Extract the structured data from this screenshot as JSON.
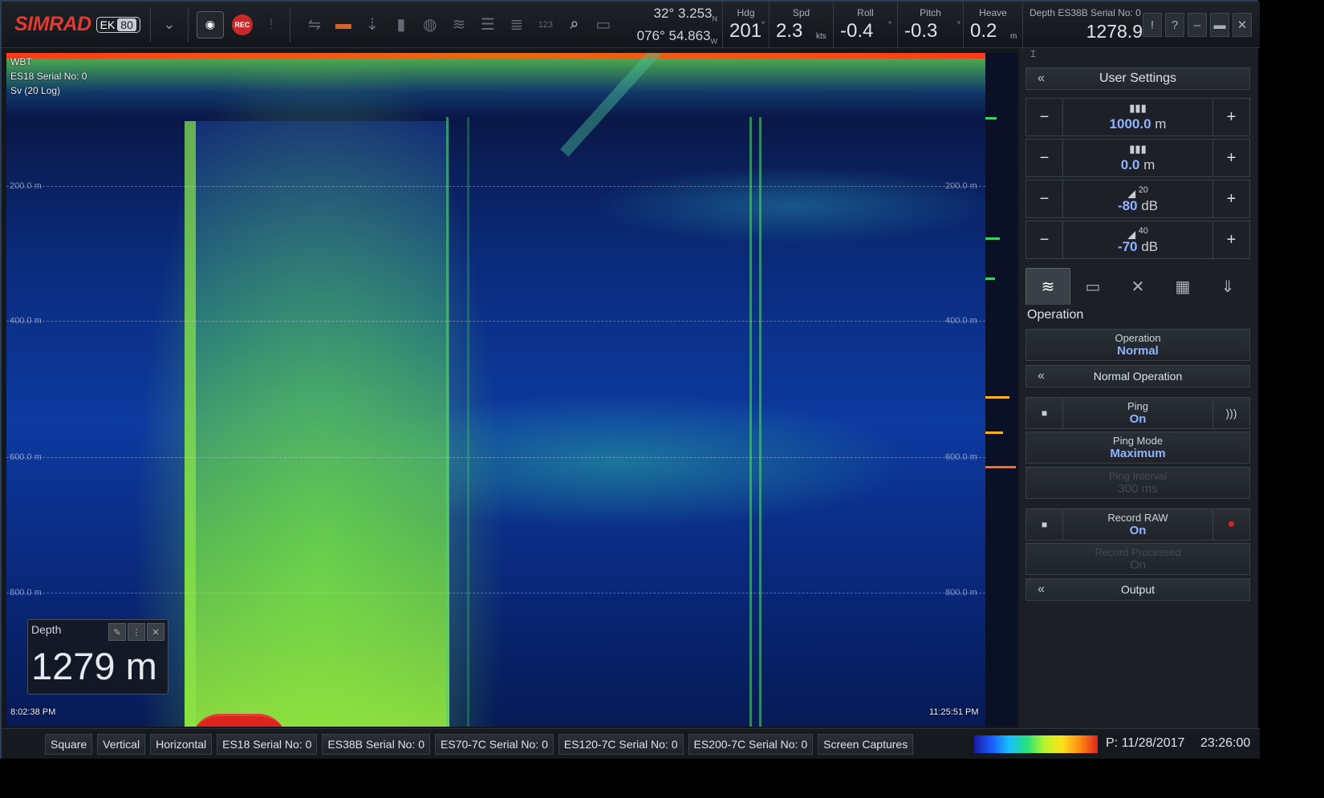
{
  "app": {
    "brand": "SIMRAD",
    "model": "EK",
    "model_num": "80"
  },
  "toolbar": {
    "rec_label": "REC",
    "icons": [
      "chevron-double-down-icon",
      "camera-icon",
      "record-icon",
      "alert-icon",
      "swap-icon",
      "palette-icon",
      "adjust-icon",
      "bar-chart-icon",
      "compass-icon",
      "echogram-icon",
      "layers-icon",
      "list-icon",
      "digits-icon",
      "magnifier-icon",
      "battery-icon"
    ]
  },
  "position": {
    "lat": "32° 3.253",
    "lat_hemi": "N",
    "lon": "076° 54.863",
    "lon_hemi": "W"
  },
  "stats": {
    "hdg": {
      "label": "Hdg",
      "value": "201",
      "unit": "°"
    },
    "spd": {
      "label": "Spd",
      "value": "2.3",
      "unit": "kts"
    },
    "roll": {
      "label": "Roll",
      "value": "-0.4",
      "unit": "°"
    },
    "pitch": {
      "label": "Pitch",
      "value": "-0.3",
      "unit": "°"
    },
    "heave": {
      "label": "Heave",
      "value": "0.2",
      "unit": "m"
    }
  },
  "depth_top": {
    "label": "Depth ES38B Serial No: 0",
    "value": "1278.9"
  },
  "echogram": {
    "mode": "WBT",
    "channel": "ES18 Serial No: 0",
    "type": "Sv (20 Log)",
    "grid": [
      "200.0 m",
      "400.0 m",
      "600.0 m",
      "800.0 m"
    ],
    "start_time": "8:02:38 PM",
    "end_time": "11:25:51 PM"
  },
  "depth_box": {
    "label": "Depth",
    "value": "1279 m"
  },
  "panel": {
    "title": "User Settings",
    "range": {
      "value": "1000.0",
      "unit": "m"
    },
    "start": {
      "value": "0.0",
      "unit": "m"
    },
    "tvg20": {
      "sup": "20",
      "value": "-80",
      "unit": "dB"
    },
    "tvg40": {
      "sup": "40",
      "value": "-70",
      "unit": "dB"
    },
    "section": "Operation",
    "operation": {
      "label": "Operation",
      "value": "Normal"
    },
    "normal_op": "Normal Operation",
    "ping": {
      "label": "Ping",
      "value": "On"
    },
    "ping_mode": {
      "label": "Ping Mode",
      "value": "Maximum"
    },
    "ping_interval": {
      "label": "Ping Interval",
      "value": "300 ms"
    },
    "record_raw": {
      "label": "Record RAW",
      "value": "On"
    },
    "record_proc": {
      "label": "Record Processed",
      "value": "On"
    },
    "output": "Output"
  },
  "bottom": {
    "tabs": [
      "Square",
      "Vertical",
      "Horizontal",
      "ES18 Serial No: 0",
      "ES38B Serial No: 0",
      "ES70-7C Serial No: 0",
      "ES120-7C Serial No: 0",
      "ES200-7C Serial No: 0",
      "Screen Captures"
    ],
    "date": "P: 11/28/2017",
    "time": "23:26:00"
  }
}
